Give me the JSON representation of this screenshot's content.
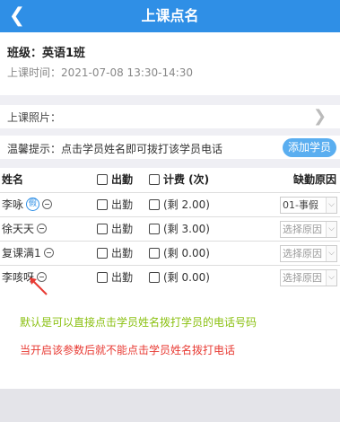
{
  "navbar": {
    "title": "上课点名",
    "back_icon": "chevron-left-icon"
  },
  "info": {
    "class_label": "班级：英语1班",
    "time_label": "上课时间：2021-07-08 13:30-14:30"
  },
  "photo": {
    "label": "上课照片：",
    "arrow_icon": "chevron-right-icon"
  },
  "tip": {
    "text": "温馨提示：点击学员姓名即可拨打该学员电话",
    "add_button": "添加学员"
  },
  "table": {
    "headers": {
      "name": "姓名",
      "attendance": "出勤",
      "fee": "计费 (次)",
      "reason": "缺勤原因"
    },
    "rows": [
      {
        "name": "李咏",
        "leave_badge": "假",
        "attendance": "出勤",
        "fee": "(剩 2.00)",
        "reason": "01-事假"
      },
      {
        "name": "徐天天",
        "attendance": "出勤",
        "fee": "(剩 3.00)",
        "reason": "选择原因"
      },
      {
        "name": "复课满1",
        "attendance": "出勤",
        "fee": "(剩 0.00)",
        "reason": "选择原因"
      },
      {
        "name": "李咳呀",
        "attendance": "出勤",
        "fee": "(剩 0.00)",
        "reason": "选择原因"
      }
    ]
  },
  "annotations": {
    "green_note": "默认是可以直接点击学员姓名拨打学员的电话号码",
    "red_note": "当开启该参数后就不能点击学员姓名拨打电话",
    "colors": {
      "green": "#8ac010",
      "red": "#e83a33"
    }
  },
  "colors": {
    "primary": "#2f8fe6",
    "button": "#5aaef0"
  }
}
